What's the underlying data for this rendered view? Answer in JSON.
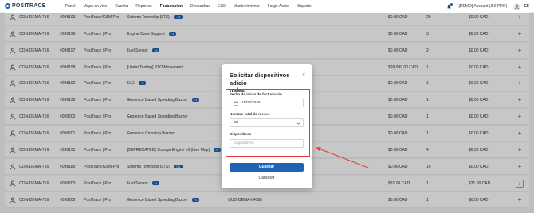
{
  "brand": {
    "name": "POSITRACE",
    "color": "#1e63b5"
  },
  "nav": [
    "Panel",
    "Mapa en vivo",
    "Cuenta",
    "Reportes",
    "Facturación",
    "Despachar",
    "ELD",
    "Mantenimiento",
    "Forge Assist",
    "Soporte"
  ],
  "active_nav": "Facturación",
  "header": {
    "account": "[DEMO] Account (3.0 PRO)",
    "lang": "ES"
  },
  "rows": [
    {
      "customer": "CON-DEMA-716",
      "id": "#098193",
      "plan": "PosiTrace/GSM Pro",
      "product": "Sistema Township (LTS)",
      "badge": "+10",
      "extra": "",
      "price": "$0.00 CAD",
      "qty": "20",
      "total": "$0.00 CAD"
    },
    {
      "customer": "CON-DEMA-716",
      "id": "#098196",
      "plan": "PosiTrace | Pro",
      "product": "Engine Code Support",
      "badge": "+1",
      "extra": "",
      "price": "$0.00 CAD",
      "qty": "3",
      "total": "$0.00 CAD"
    },
    {
      "customer": "CON-DEMA-716",
      "id": "#098197",
      "plan": "PosiTrace | Pro",
      "product": "Fuel Sensor",
      "badge": "+1",
      "extra": "",
      "price": "$0.00 CAD",
      "qty": "2",
      "total": "$0.00 CAD"
    },
    {
      "customer": "CON-DEMA-716",
      "id": "#098198",
      "plan": "PosiTrace | Pro",
      "product": "[Under Testing] PTO Movement",
      "badge": "",
      "extra": "",
      "price": "$99,999.00 CAD",
      "qty": "1",
      "total": "$0.00 CAD"
    },
    {
      "customer": "CON-DEMA-716",
      "id": "#098192",
      "plan": "PosiTrace | Pro",
      "product": "ELD",
      "badge": "+6",
      "extra": "",
      "price": "$0.00 CAD",
      "qty": "1",
      "total": "$0.00 CAD"
    },
    {
      "customer": "CON-DEMA-716",
      "id": "#098199",
      "plan": "PosiTrace | Pro",
      "product": "Geofence Based Speeding Buzzer",
      "badge": "+1",
      "extra": "",
      "price": "$0.00 CAD",
      "qty": "1",
      "total": "$0.00 CAD"
    },
    {
      "customer": "CON-DEMA-716",
      "id": "#098200",
      "plan": "PosiTrace | Pro",
      "product": "Geofence Based Speeding Buzzer",
      "badge": "",
      "extra": "",
      "price": "$0.00 CAD",
      "qty": "1",
      "total": "$0.00 CAD"
    },
    {
      "customer": "CON-DEMA-716",
      "id": "#098201",
      "plan": "PosiTrace | Pro",
      "product": "Geofence Crossing Buzzer",
      "badge": "",
      "extra": "",
      "price": "$0.00 CAD",
      "qty": "1",
      "total": "$0.00 CAD"
    },
    {
      "customer": "CON-DEMA-716",
      "id": "#098191",
      "plan": "PosiTrace | Pro",
      "product": "[DEPRECATED] Storage Engine v3 (Live Map)",
      "badge": "+2",
      "extra": "",
      "price": "$0.00 CAD",
      "qty": "4",
      "total": "$0.00 CAD"
    },
    {
      "customer": "CON-DEMA-716",
      "id": "#098189",
      "plan": "PosiTrace/GSM Pro",
      "product": "Sistema Township (LTS)",
      "badge": "+21",
      "extra": "",
      "price": "$0.00 CAD",
      "qty": "16",
      "total": "$0.00 CAD"
    },
    {
      "customer": "CON-DEMA-716",
      "id": "#098203",
      "plan": "PosiTrace | Pro",
      "product": "Fuel Sensor",
      "badge": "+1",
      "extra": "36",
      "price": "$31.00 CAD",
      "qty": "1",
      "total": "$31.00 CAD"
    },
    {
      "customer": "CON-DEMA-716",
      "id": "#098209",
      "plan": "PosiTrace | Pro",
      "product": "Geofence Based Speeding Buzzer",
      "badge": "+1",
      "extra": "QUO-DEMA-84585",
      "price": "$0.00 CAD",
      "qty": "1",
      "total": "$0.00 CAD"
    }
  ],
  "modal": {
    "title": "Solicitar dispositivos adicionales",
    "title_line1": "Solicitar dispositivos adicio",
    "title_line2": "nales",
    "start_date_label": "Fecha de inicio de facturación",
    "start_date_value": "11/03/2026",
    "months_label": "Nombre total de meses",
    "months_value": "36",
    "devices_label": "Dispositivos",
    "devices_placeholder": "Dispositivos",
    "submit": "Guardar",
    "cancel": "Cancelar"
  },
  "colors": {
    "primary": "#1e63b5",
    "annotation": "#e53b3b",
    "overlay": "rgba(0,0,0,0.22)"
  }
}
